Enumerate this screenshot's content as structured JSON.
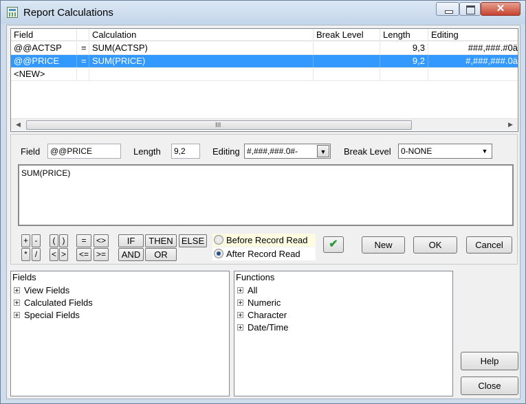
{
  "window": {
    "title": "Report Calculations",
    "icon": "calculator-icon",
    "close_glyph": "✕"
  },
  "grid": {
    "columns": [
      "Field",
      "",
      "Calculation",
      "Break Level",
      "Length",
      "Editing"
    ],
    "rows": [
      {
        "field": "@@ACTSP",
        "eq": "=",
        "calculation": "SUM(ACTSP)",
        "break_level": "",
        "length": "9,3",
        "editing": "###,###.#0ä",
        "selected": false
      },
      {
        "field": "@@PRICE",
        "eq": "=",
        "calculation": "SUM(PRICE)",
        "break_level": "",
        "length": "9,2",
        "editing": "#,###,###.0ä",
        "selected": true
      },
      {
        "field": "<NEW>",
        "eq": "",
        "calculation": "",
        "break_level": "",
        "length": "",
        "editing": "",
        "selected": false
      }
    ],
    "scroll_grip": "III",
    "scroll_left": "◀",
    "scroll_right": "▶"
  },
  "editor": {
    "field_label": "Field",
    "field_value": "@@PRICE",
    "length_label": "Length",
    "length_value": "9,2",
    "editing_label": "Editing",
    "editing_value": "#,###,###.0#-",
    "break_level_label": "Break Level",
    "break_level_value": "0-NONE",
    "calculation_text": "SUM(PRICE)"
  },
  "operators": {
    "plus": "+",
    "minus": "-",
    "lparen": "(",
    "rparen": ")",
    "eq": "=",
    "ne": "<>",
    "mul": "*",
    "div": "/",
    "lt": "<",
    "gt": ">",
    "le": "<=",
    "ge": ">=",
    "if": "IF",
    "then": "THEN",
    "else": "ELSE",
    "and": "AND",
    "or": "OR"
  },
  "timing": {
    "before_label": "Before Record Read",
    "after_label": "After Record Read",
    "selected": "after"
  },
  "buttons": {
    "check": "✔",
    "new": "New",
    "ok": "OK",
    "cancel": "Cancel",
    "help": "Help",
    "close": "Close"
  },
  "fields_tree": {
    "title": "Fields",
    "items": [
      "View Fields",
      "Calculated Fields",
      "Special Fields"
    ]
  },
  "functions_tree": {
    "title": "Functions",
    "items": [
      "All",
      "Numeric",
      "Character",
      "Date/Time"
    ]
  },
  "colors": {
    "selection": "#3399ff",
    "check_green": "#2e9a3a",
    "close_red": "#c7422f"
  }
}
